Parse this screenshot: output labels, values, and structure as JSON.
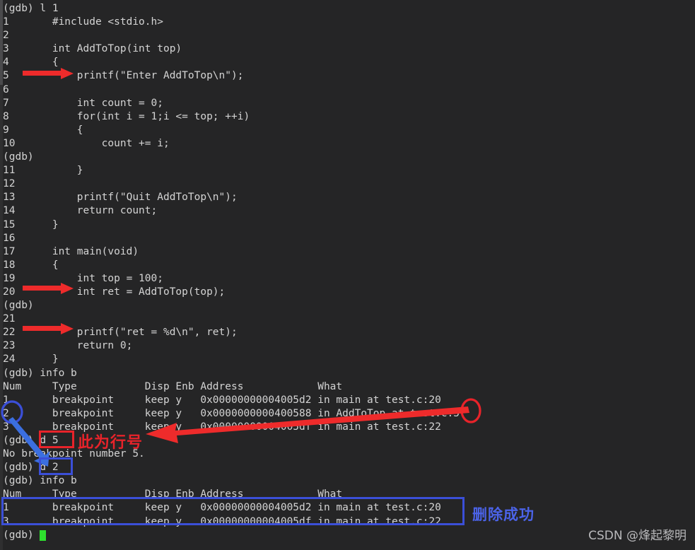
{
  "terminal": {
    "background": "#252526",
    "foreground": "#d4d4d4",
    "cursor_color": "#2ee02e",
    "lines": [
      "(gdb) l 1",
      "1       #include <stdio.h>",
      "2",
      "3       int AddToTop(int top)",
      "4       {",
      "5           printf(\"Enter AddToTop\\n\");",
      "6",
      "7           int count = 0;",
      "8           for(int i = 1;i <= top; ++i)",
      "9           {",
      "10              count += i;",
      "(gdb)",
      "11          }",
      "12",
      "13          printf(\"Quit AddToTop\\n\");",
      "14          return count;",
      "15      }",
      "16",
      "17      int main(void)",
      "18      {",
      "19          int top = 100;",
      "20          int ret = AddToTop(top);",
      "(gdb)",
      "21",
      "22          printf(\"ret = %d\\n\", ret);",
      "23          return 0;",
      "24      }",
      "(gdb) info b",
      "Num     Type           Disp Enb Address            What",
      "1       breakpoint     keep y   0x00000000004005d2 in main at test.c:20",
      "2       breakpoint     keep y   0x0000000000400588 in AddToTop at test.c:5",
      "3       breakpoint     keep y   0x00000000004005df in main at test.c:22",
      "(gdb) d 5",
      "No breakpoint number 5.",
      "(gdb) d 2",
      "(gdb) info b",
      "Num     Type           Disp Enb Address            What",
      "1       breakpoint     keep y   0x00000000004005d2 in main at test.c:20",
      "3       breakpoint     keep y   0x00000000004005df in main at test.c:22",
      "(gdb) "
    ]
  },
  "breakpoint_table_1": {
    "command": "info b",
    "columns": [
      "Num",
      "Type",
      "Disp",
      "Enb",
      "Address",
      "What"
    ],
    "rows": [
      [
        "1",
        "breakpoint",
        "keep",
        "y",
        "0x00000000004005d2",
        "in main at test.c:20"
      ],
      [
        "2",
        "breakpoint",
        "keep",
        "y",
        "0x0000000000400588",
        "in AddToTop at test.c:5"
      ],
      [
        "3",
        "breakpoint",
        "keep",
        "y",
        "0x00000000004005df",
        "in main at test.c:22"
      ]
    ]
  },
  "breakpoint_table_2": {
    "command": "info b",
    "columns": [
      "Num",
      "Type",
      "Disp",
      "Enb",
      "Address",
      "What"
    ],
    "rows": [
      [
        "1",
        "breakpoint",
        "keep",
        "y",
        "0x00000000004005d2",
        "in main at test.c:20"
      ],
      [
        "3",
        "breakpoint",
        "keep",
        "y",
        "0x00000000004005df",
        "in main at test.c:22"
      ]
    ]
  },
  "commands": {
    "list": "l 1",
    "info_breakpoints": "info b",
    "delete_5": "d 5",
    "delete_2": "d 2",
    "error_message": "No breakpoint number 5."
  },
  "annotations": {
    "red_color": "#e8232a",
    "blue_color": "#3b4fd8",
    "line_number_note": "此为行号",
    "delete_success_note": "删除成功",
    "circled_breakpoint_num": "2",
    "circled_line_num": "5",
    "boxed_command_red": "d 5",
    "boxed_command_blue": "d 2"
  },
  "watermark": {
    "text": "CSDN @烽起黎明"
  }
}
